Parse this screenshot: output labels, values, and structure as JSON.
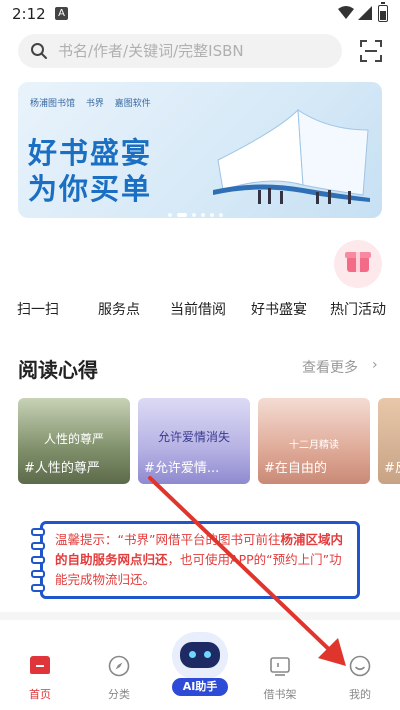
{
  "status_bar": {
    "time": "2:12",
    "indicator": "A"
  },
  "search": {
    "placeholder": "书名/作者/关键词/完整ISBN"
  },
  "banner": {
    "logos": [
      "杨浦图书馆",
      "书界",
      "嘉图软件"
    ],
    "line1": "好书盛宴",
    "line2": "为你买单",
    "slides": 6,
    "active_slide": 2
  },
  "quick_actions": [
    {
      "label": "扫一扫"
    },
    {
      "label": "服务点"
    },
    {
      "label": "当前借阅"
    },
    {
      "label": "好书盛宴"
    },
    {
      "label": "热门活动"
    }
  ],
  "reading": {
    "title": "阅读心得",
    "more": "查看更多",
    "cards": [
      {
        "title": "人性的尊严",
        "tag": "#人性的尊严",
        "bg": "#8b9a72"
      },
      {
        "title": "允许爱情消失",
        "tag": "#允许爱情...",
        "bg": "#b9b6e3"
      },
      {
        "subtitle": "十二月精读",
        "tag": "#在自由的",
        "bg": "#d9a99a"
      },
      {
        "tag": "#反",
        "bg": "#c9a58a"
      }
    ]
  },
  "notice": {
    "part1": "温馨提示：“书界”网借平台的图书可前往",
    "highlight": "杨浦区域内的自助服务网点归还",
    "part2": "，也可使用APP的“预约上门”功能完成物流归还。"
  },
  "tabs": [
    {
      "label": "首页",
      "active": true
    },
    {
      "label": "分类"
    },
    {
      "label": "AI助手"
    },
    {
      "label": "借书架"
    },
    {
      "label": "我的"
    }
  ],
  "colors": {
    "accent": "#e0353b",
    "ai_blue": "#2e4bd8",
    "notice_border": "#1f56c9",
    "notice_text": "#e23c3c"
  }
}
